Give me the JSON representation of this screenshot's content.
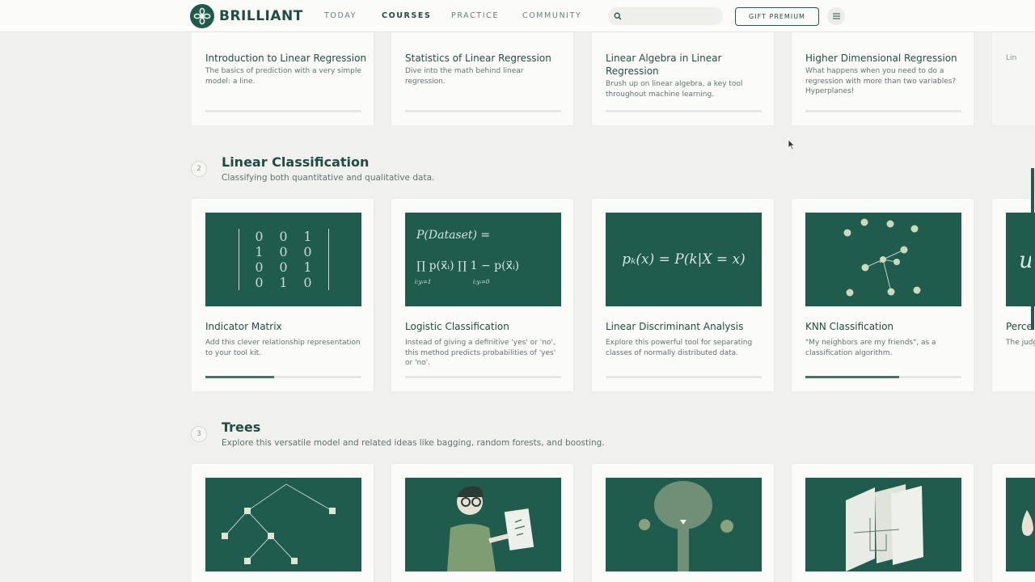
{
  "brand": {
    "name": "BRILLIANT"
  },
  "nav": {
    "today": "TODAY",
    "courses": "COURSES",
    "practice": "PRACTICE",
    "community": "COMMUNITY",
    "search_placeholder": "",
    "gift_label": "GIFT PREMIUM"
  },
  "section1": {
    "cards": [
      {
        "title": "Introduction to Linear Regression",
        "desc": "The basics of prediction with a very simple model: a line."
      },
      {
        "title": "Statistics of Linear Regression",
        "desc": "Dive into the math behind linear regression."
      },
      {
        "title": "Linear Algebra in Linear Regression",
        "desc": "Brush up on linear algebra, a key tool throughout machine learning."
      },
      {
        "title": "Higher Dimensional Regression",
        "desc": "What happens when you need to do a regression with more than two variables? Hyperplanes!"
      },
      {
        "title": "Lin",
        "desc": ""
      }
    ]
  },
  "section2": {
    "number": "2",
    "title": "Linear Classification",
    "subtitle": "Classifying both quantitative and qualitative data.",
    "cards": [
      {
        "title": "Indicator Matrix",
        "desc": "Add this clever relationship representation to your tool kit.",
        "progress": 0.44
      },
      {
        "title": "Logistic Classification",
        "desc": "Instead of giving a definitive 'yes' or 'no', this method predicts probabilities of 'yes' or 'no'.",
        "progress": 0
      },
      {
        "title": "Linear Discriminant Analysis",
        "desc": "Explore this powerful tool for separating classes of normally distributed data.",
        "progress": 0
      },
      {
        "title": "KNN Classification",
        "desc": "\"My neighbors are my friends\", as a classification algorithm.",
        "progress": 0.6
      },
      {
        "title": "Perce",
        "desc": "The judg"
      }
    ],
    "thumb_text": {
      "matrix": [
        [
          "0",
          "0",
          "1"
        ],
        [
          "1",
          "0",
          "0"
        ],
        [
          "0",
          "0",
          "1"
        ],
        [
          "0",
          "1",
          "0"
        ]
      ],
      "logistic_line1": "P(Dataset) =",
      "logistic_line2": "∏ p(x⃗ᵢ) ∏ 1 − p(x⃗ᵢ)",
      "logistic_sub1": "i:yᵢ=1",
      "logistic_sub2": "i:yᵢ=0",
      "lda": "pₖ(x) = P(k|X = x)",
      "partial": "u"
    }
  },
  "section3": {
    "number": "3",
    "title": "Trees",
    "subtitle": "Explore this versatile model and related ideas like bagging, random forests, and boosting."
  },
  "colors": {
    "brand_green": "#1f5c4d",
    "text": "#1f4d43",
    "bg": "#f0f0ee"
  },
  "icons": [
    "logo-icon",
    "search-icon",
    "hamburger-icon",
    "mouse-cursor-icon"
  ]
}
